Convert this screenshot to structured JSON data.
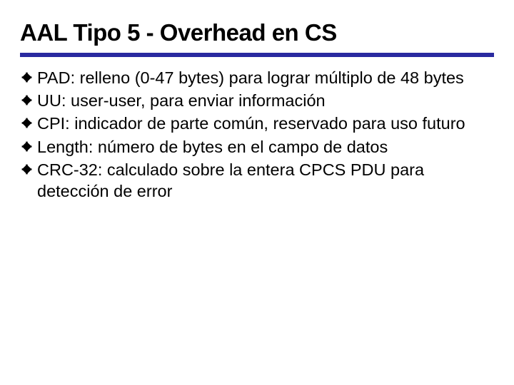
{
  "title": "AAL Tipo 5 - Overhead en CS",
  "bullets": {
    "b0": "PAD: relleno (0-47 bytes) para lograr múltiplo de 48 bytes",
    "b1": "UU: user-user, para enviar información",
    "b2": "CPI: indicador de parte común, reservado para uso futuro",
    "b3": "Length: número de bytes en el campo de datos",
    "b4": "CRC-32: calculado sobre la entera CPCS PDU para detección de error"
  }
}
